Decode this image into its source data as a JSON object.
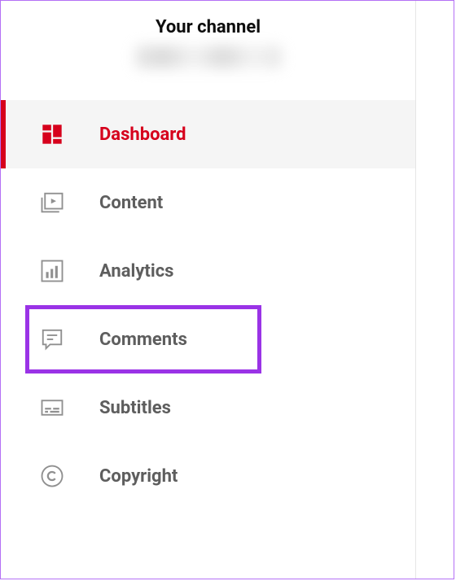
{
  "header": {
    "title": "Your channel"
  },
  "nav": {
    "items": [
      {
        "key": "dashboard",
        "label": "Dashboard",
        "icon": "dashboard-icon",
        "active": true
      },
      {
        "key": "content",
        "label": "Content",
        "icon": "content-icon",
        "active": false
      },
      {
        "key": "analytics",
        "label": "Analytics",
        "icon": "analytics-icon",
        "active": false
      },
      {
        "key": "comments",
        "label": "Comments",
        "icon": "comments-icon",
        "active": false,
        "highlighted": true
      },
      {
        "key": "subtitles",
        "label": "Subtitles",
        "icon": "subtitles-icon",
        "active": false
      },
      {
        "key": "copyright",
        "label": "Copyright",
        "icon": "copyright-icon",
        "active": false
      }
    ]
  },
  "colors": {
    "accent": "#d6001c",
    "highlight": "#9a33e6",
    "text_inactive": "#5e5e5e",
    "icon_inactive": "#909090"
  }
}
